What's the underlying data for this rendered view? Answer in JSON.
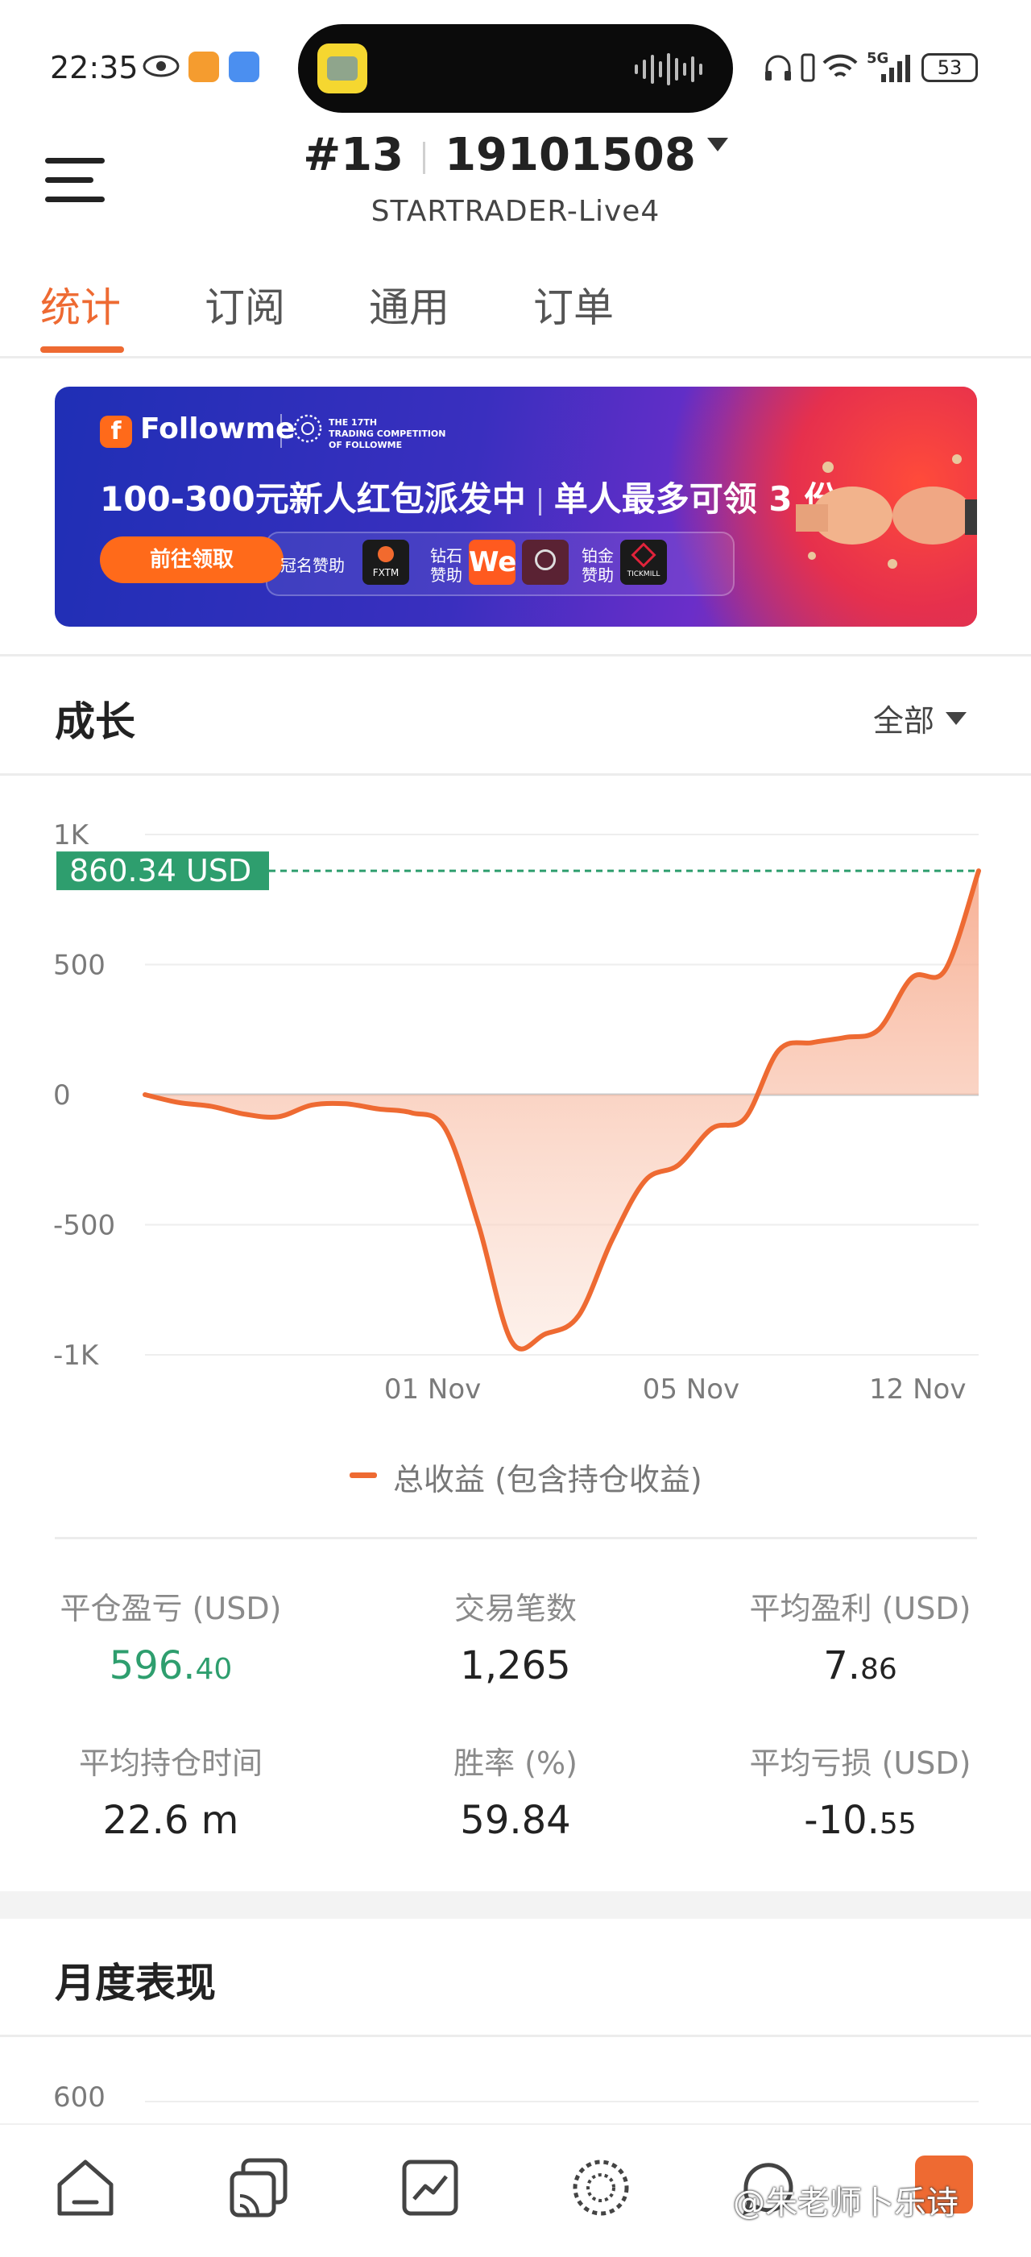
{
  "status_bar": {
    "time": "22:35",
    "network": "5G",
    "battery": "53",
    "icons": [
      "eye-icon",
      "heart-app-icon",
      "browser-app-icon",
      "headphones-icon",
      "vibrate-icon",
      "wifi-icon",
      "signal-icon",
      "battery-icon"
    ]
  },
  "header": {
    "rank": "#13",
    "account_number": "19101508",
    "server": "STARTRADER-Live4"
  },
  "tabs": [
    {
      "label": "统计",
      "active": true
    },
    {
      "label": "订阅",
      "active": false
    },
    {
      "label": "通用",
      "active": false
    },
    {
      "label": "订单",
      "active": false
    }
  ],
  "banner": {
    "brand": "Followme",
    "competition_line1": "THE 17TH",
    "competition_line2": "TRADING COMPETITION",
    "competition_line3": "OF FOLLOWME",
    "title_part1": "100-300元新人红包派发中",
    "title_part2": "单人最多可领 3 份",
    "cta": "前往领取",
    "sponsors": [
      {
        "label_l1": "冠名赞助",
        "label_l2": "",
        "logo": "FXTM"
      },
      {
        "label_l1": "钻石",
        "label_l2": "赞助",
        "logo": "We"
      },
      {
        "label_l1": "铂金",
        "label_l2": "赞助",
        "logo": "TICKMILL"
      }
    ],
    "colors": {
      "start": "#1f2fb5",
      "end": "#d8364f",
      "cta": "#ff6a1a"
    }
  },
  "growth": {
    "title": "成长",
    "filter": "全部",
    "current_value_label": "860.34 USD",
    "legend": "总收益 (包含持仓收益)"
  },
  "chart_data": {
    "type": "area",
    "series": [
      {
        "name": "总收益 (包含持仓收益)",
        "color": "#ee6a32",
        "values": [
          0,
          -30,
          -45,
          -75,
          -85,
          -40,
          -35,
          -55,
          -70,
          -130,
          -500,
          -950,
          -920,
          -850,
          -560,
          -330,
          -270,
          -130,
          -90,
          170,
          200,
          220,
          250,
          450,
          480,
          860.34
        ]
      }
    ],
    "x_tick_labels": [
      "01 Nov",
      "05 Nov",
      "12 Nov"
    ],
    "y_ticks": [
      -1000,
      -500,
      0,
      500,
      1000
    ],
    "y_tick_labels": [
      "-1K",
      "-500",
      "0",
      "500",
      "1K"
    ],
    "ylim": [
      -1000,
      1000
    ],
    "reference_line": {
      "value": 860.34,
      "label": "860.34 USD",
      "color": "#2e9e6e"
    },
    "grid": true
  },
  "stats": [
    {
      "label": "平仓盈亏 (USD)",
      "int": "596.",
      "dec": "40",
      "color": "#2e9e6e"
    },
    {
      "label": "交易笔数",
      "int": "1,265",
      "dec": "",
      "color": "#222222"
    },
    {
      "label": "平均盈利 (USD)",
      "int": "7.",
      "dec": "86",
      "color": "#222222"
    },
    {
      "label": "平均持仓时间",
      "int": "22.6 m",
      "dec": "",
      "color": "#222222"
    },
    {
      "label": "胜率 (%)",
      "int": "59.84",
      "dec": "",
      "color": "#222222"
    },
    {
      "label": "平均亏损 (USD)",
      "int": "-10.",
      "dec": "55",
      "color": "#222222"
    }
  ],
  "monthly": {
    "title": "月度表现",
    "first_tick": "600"
  },
  "bottom_nav": [
    "home-icon",
    "copy-cast-icon",
    "chart-icon",
    "globe-icon",
    "chat-icon",
    "profile-icon"
  ],
  "watermark": "@朱老师卜乐诗"
}
